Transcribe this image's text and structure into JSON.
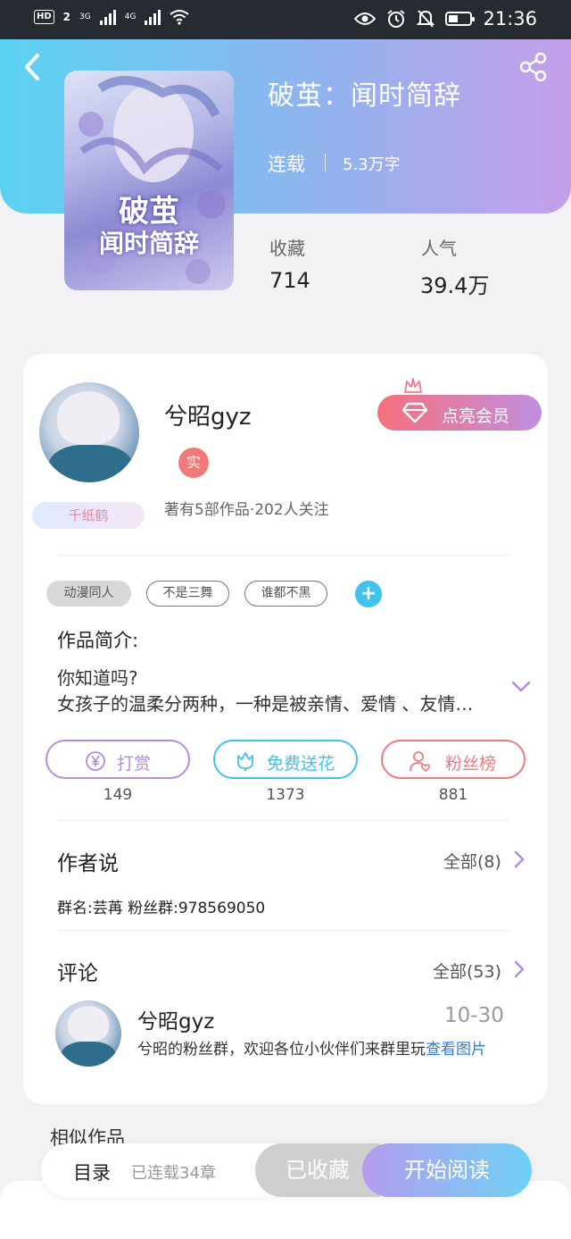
{
  "status_bar": {
    "hd_label": "HD",
    "sim1_label": "2",
    "net1": "3G",
    "net2": "4G",
    "time": "21:36",
    "icons": [
      "eye-icon",
      "alarm-icon",
      "mute-icon",
      "battery-icon"
    ]
  },
  "header": {
    "book_title": "破茧：闻时简辞",
    "status": "连载",
    "word_count": "5.3万字",
    "cover_title_line1": "破茧",
    "cover_title_line2": "闻时简辞",
    "stats": [
      {
        "label": "收藏",
        "value": "714"
      },
      {
        "label": "人气",
        "value": "39.4万"
      }
    ],
    "gradient_colors": [
      "#5bd3f3",
      "#8fb4ee",
      "#c59fe9"
    ]
  },
  "author": {
    "name": "兮昭gyz",
    "real_badge": "实",
    "meta": "著有5部作品·202人关注",
    "badge": "千纸鹤",
    "vip_button": "点亮会员"
  },
  "tags": [
    "动漫同人",
    "不是三舞",
    "谁都不黑"
  ],
  "tag_add_label": "+",
  "intro": {
    "label": "作品简介:",
    "line1": "你知道吗?",
    "line2": "女孩子的温柔分两种，一种是被亲情、爱情 、友情…"
  },
  "actions": [
    {
      "label": "打赏",
      "count": "149",
      "color": "#b38cdf",
      "icon": "yen-coin-icon"
    },
    {
      "label": "免费送花",
      "count": "1373",
      "color": "#3fc2ee",
      "icon": "flower-icon"
    },
    {
      "label": "粉丝榜",
      "count": "881",
      "color": "#ee7a7f",
      "icon": "fan-ranking-icon"
    }
  ],
  "author_says": {
    "title": "作者说",
    "more": "全部(8)",
    "text": "群名:芸苒 粉丝群:978569050"
  },
  "comments": {
    "title": "评论",
    "more": "全部(53)",
    "items": [
      {
        "user": "兮昭gyz",
        "date": "10-30",
        "text": "兮昭的粉丝群，欢迎各位小伙伴们来群里玩",
        "link": "查看图片"
      }
    ]
  },
  "similar": {
    "title": "相似作品"
  },
  "bottom_bar": {
    "toc": "目录",
    "chapters": "已连载34章",
    "collected": "已收藏",
    "read": "开始阅读"
  }
}
